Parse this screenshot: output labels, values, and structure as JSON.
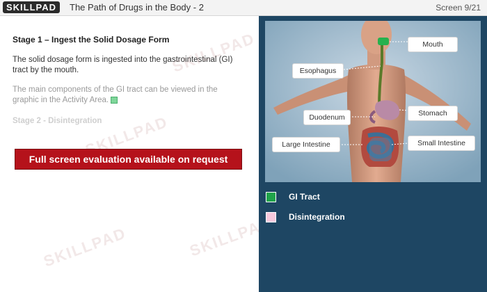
{
  "header": {
    "logo_text": "SKILLPAD",
    "title": "The Path of Drugs in the Body - 2",
    "screen_counter": "Screen 9/21"
  },
  "content": {
    "stage1_heading": "Stage 1 – Ingest the Solid Dosage Form",
    "paragraph1": "The solid dosage form is ingested into the gastrointestinal (GI) tract by the mouth.",
    "paragraph2": "The main components of the GI tract can be viewed in the graphic in the Activity Area.",
    "stage2_heading": "Stage 2 - Disintegration",
    "eval_banner": "Full screen evaluation available on request"
  },
  "graphic": {
    "labels": {
      "mouth": "Mouth",
      "esophagus": "Esophagus",
      "duodenum": "Duodenum",
      "stomach": "Stomach",
      "large_intestine": "Large Intestine",
      "small_intestine": "Small Intestine"
    }
  },
  "legend": [
    {
      "label": "GI Tract",
      "color": "#1fa34a"
    },
    {
      "label": "Disintegration",
      "color": "#f6c9dd"
    }
  ],
  "watermark": "SKILLPAD"
}
